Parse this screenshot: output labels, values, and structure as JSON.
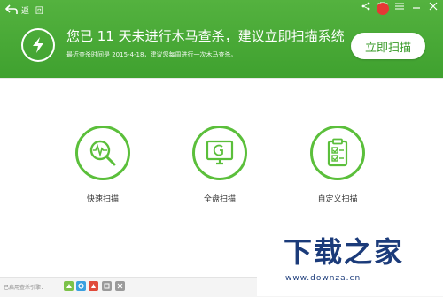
{
  "window": {
    "back_label": "返 回",
    "controls": [
      "share-icon",
      "skin-icon",
      "menu-icon",
      "minimize-icon",
      "close-icon"
    ]
  },
  "banner": {
    "headline": "您已 11 天未进行木马查杀，建议立即扫描系统",
    "subline": "最近查杀时间是 2015-4-18，建议您每周进行一次木马查杀。",
    "scan_button": "立即扫描",
    "colors": {
      "banner": "#4aab36",
      "accent": "#5bbf3b"
    }
  },
  "scan_options": [
    {
      "label": "快速扫描",
      "icon": "magnifier-pulse-icon"
    },
    {
      "label": "全盘扫描",
      "icon": "monitor-icon"
    },
    {
      "label": "自定义扫描",
      "icon": "checklist-icon"
    }
  ],
  "footer": {
    "engines_label": "已启用查杀引擎：",
    "engines": [
      {
        "icon": "cloud-engine-icon",
        "color": "#7cc24a"
      },
      {
        "icon": "qvm-engine-icon",
        "color": "#3aa0e0"
      },
      {
        "icon": "avira-engine-icon",
        "color": "#e04a3a"
      },
      {
        "icon": "system-repair-engine-icon",
        "color": "#9a9a9a"
      },
      {
        "icon": "bitdefender-engine-icon",
        "color": "#9a9a9a"
      }
    ]
  },
  "watermark": {
    "title": "下载之家",
    "url": "www.downza.cn"
  }
}
